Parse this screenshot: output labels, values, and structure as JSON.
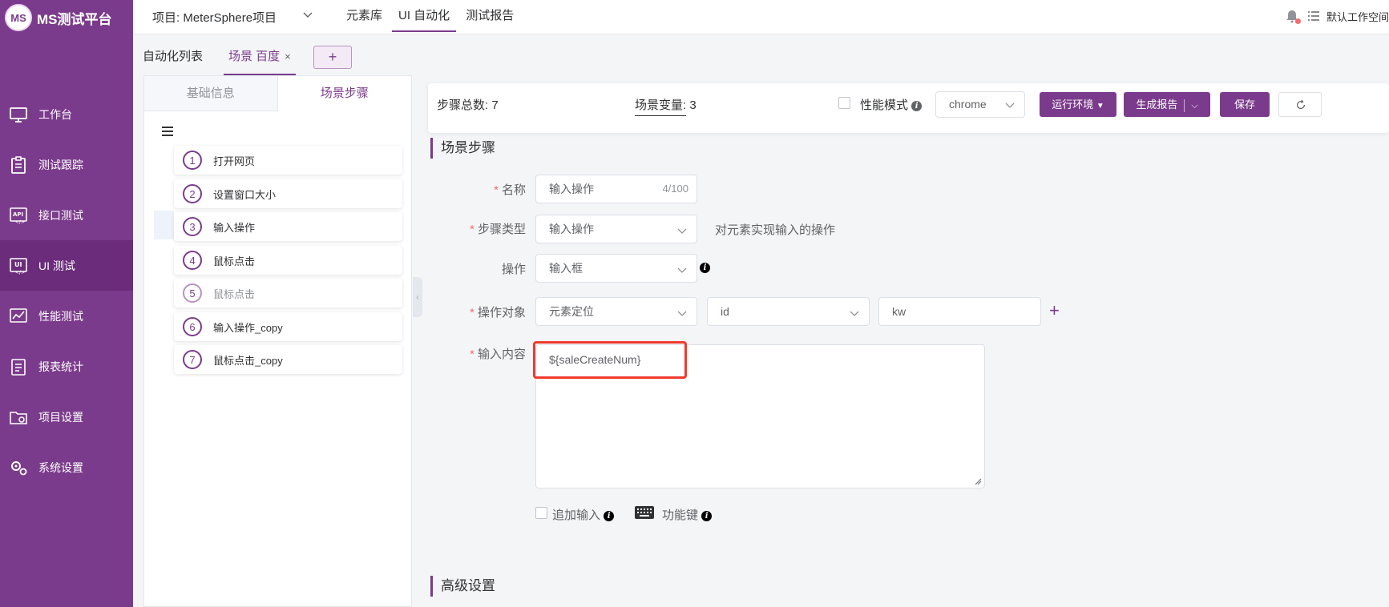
{
  "app": {
    "logo_mark": "MS",
    "name": "MS测试平台"
  },
  "sidebar": {
    "items": [
      {
        "label": "工作台",
        "icon": "monitor-icon"
      },
      {
        "label": "测试跟踪",
        "icon": "clipboard-icon"
      },
      {
        "label": "接口测试",
        "icon": "api-icon"
      },
      {
        "label": "UI 测试",
        "icon": "ui-icon"
      },
      {
        "label": "性能测试",
        "icon": "chart-icon"
      },
      {
        "label": "报表统计",
        "icon": "report-icon"
      },
      {
        "label": "项目设置",
        "icon": "folder-gear-icon"
      },
      {
        "label": "系统设置",
        "icon": "gears-icon"
      }
    ],
    "active_index": 3
  },
  "topbar": {
    "project": "项目: MeterSphere项目",
    "nav": [
      "元素库",
      "UI 自动化",
      "测试报告"
    ],
    "active_nav": 1,
    "workspace": "默认工作空间"
  },
  "tabs": {
    "list_label": "自动化列表",
    "scene_label": "场景 百度",
    "close": "×",
    "add": "+"
  },
  "step_panel": {
    "tabs": [
      "基础信息",
      "场景步骤"
    ],
    "active_tab": 1,
    "steps": [
      {
        "num": "1",
        "label": "打开网页",
        "enabled": true
      },
      {
        "num": "2",
        "label": "设置窗口大小",
        "enabled": true
      },
      {
        "num": "3",
        "label": "输入操作",
        "enabled": true
      },
      {
        "num": "4",
        "label": "鼠标点击",
        "enabled": true
      },
      {
        "num": "5",
        "label": "鼠标点击",
        "enabled": false
      },
      {
        "num": "6",
        "label": "输入操作_copy",
        "enabled": true
      },
      {
        "num": "7",
        "label": "鼠标点击_copy",
        "enabled": true
      }
    ]
  },
  "toolbar": {
    "step_total": "步骤总数: 7",
    "scene_var_label": "场景变量:",
    "scene_var_value": "3",
    "perf_mode": "性能模式",
    "browser": "chrome",
    "env_button": "运行环境",
    "report_button": "生成报告",
    "save_button": "保存"
  },
  "form": {
    "section_title": "场景步骤",
    "name_label": "名称",
    "name_value": "输入操作",
    "name_counter": "4/100",
    "step_type_label": "步骤类型",
    "step_type_value": "输入操作",
    "step_type_hint": "对元素实现输入的操作",
    "operation_label": "操作",
    "operation_value": "输入框",
    "target_label": "操作对象",
    "locator_type": "元素定位",
    "locator_by": "id",
    "locator_value": "kw",
    "input_label": "输入内容",
    "input_value": "${saleCreateNum}",
    "append_label": "追加输入",
    "function_key_label": "功能键",
    "advanced_title": "高级设置"
  },
  "colors": {
    "brand": "#7b3b8c",
    "highlight": "#f03a2e"
  }
}
